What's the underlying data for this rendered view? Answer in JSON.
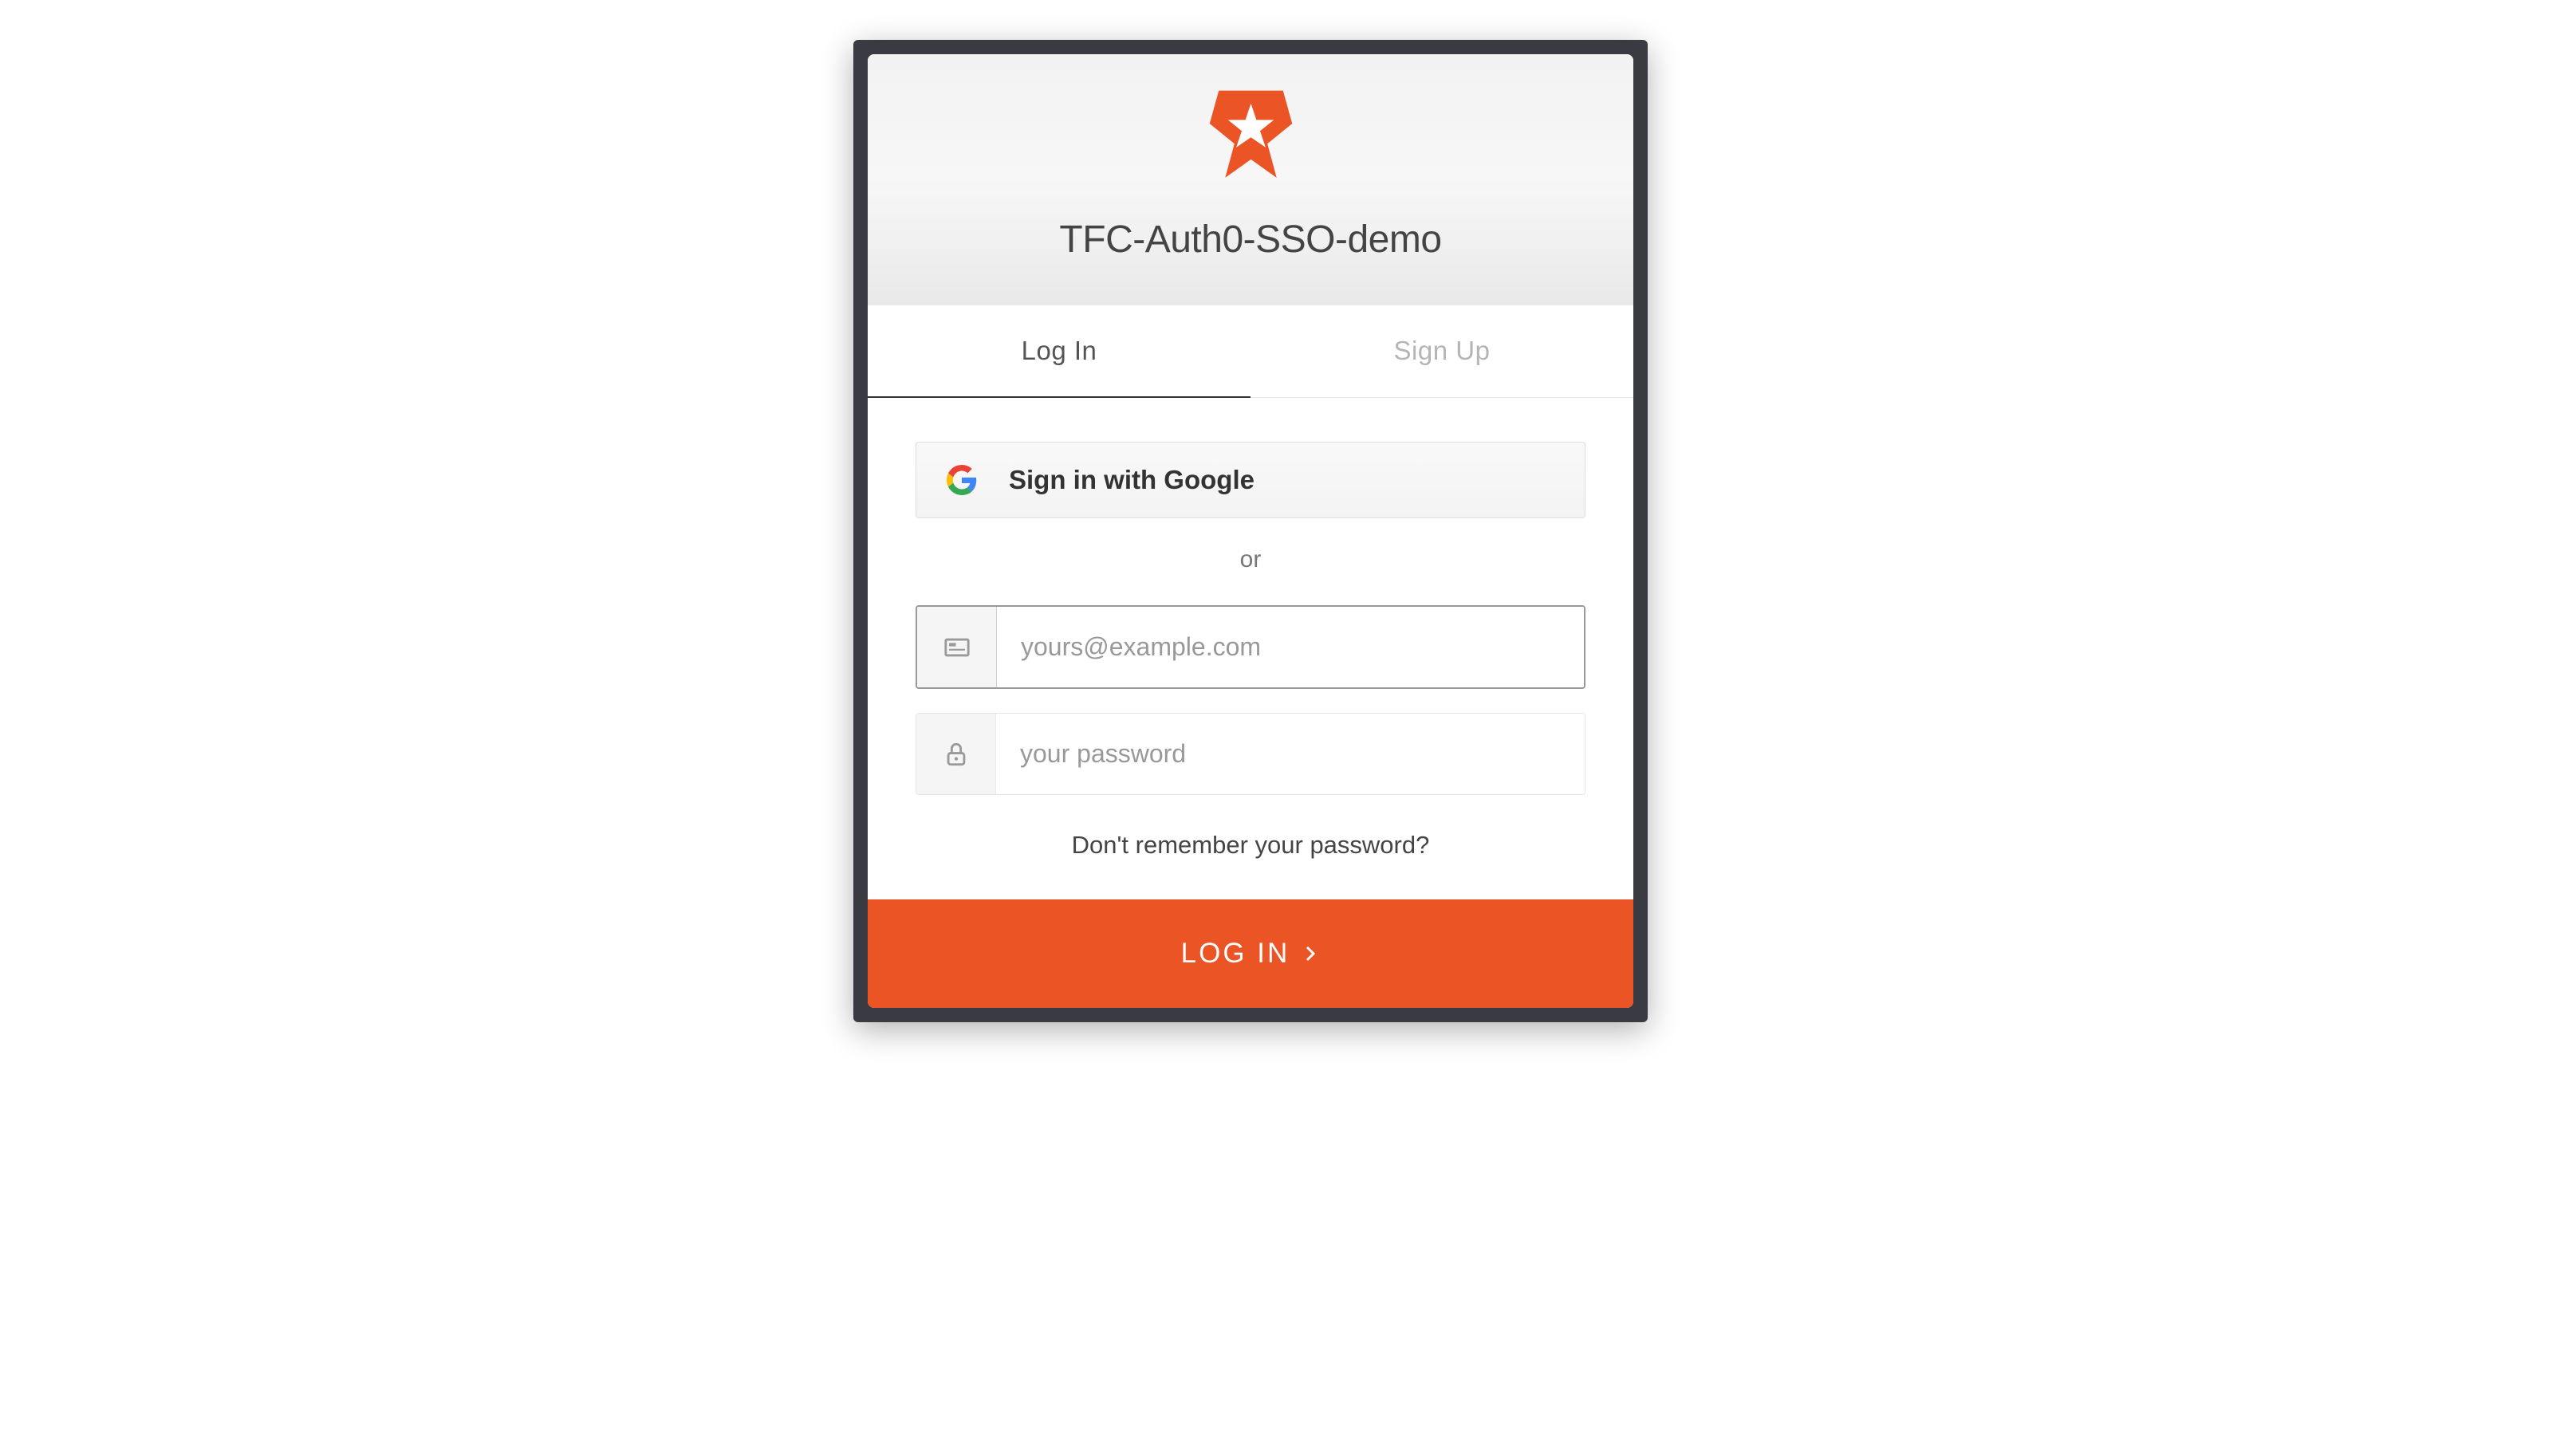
{
  "header": {
    "title": "TFC-Auth0-SSO-demo"
  },
  "tabs": {
    "login": "Log In",
    "signup": "Sign Up"
  },
  "social": {
    "google_label": "Sign in with Google"
  },
  "separator": "or",
  "inputs": {
    "email_placeholder": "yours@example.com",
    "password_placeholder": "your password"
  },
  "forgot_password": "Don't remember your password?",
  "submit_label": "LOG IN",
  "colors": {
    "accent": "#eb5424"
  }
}
